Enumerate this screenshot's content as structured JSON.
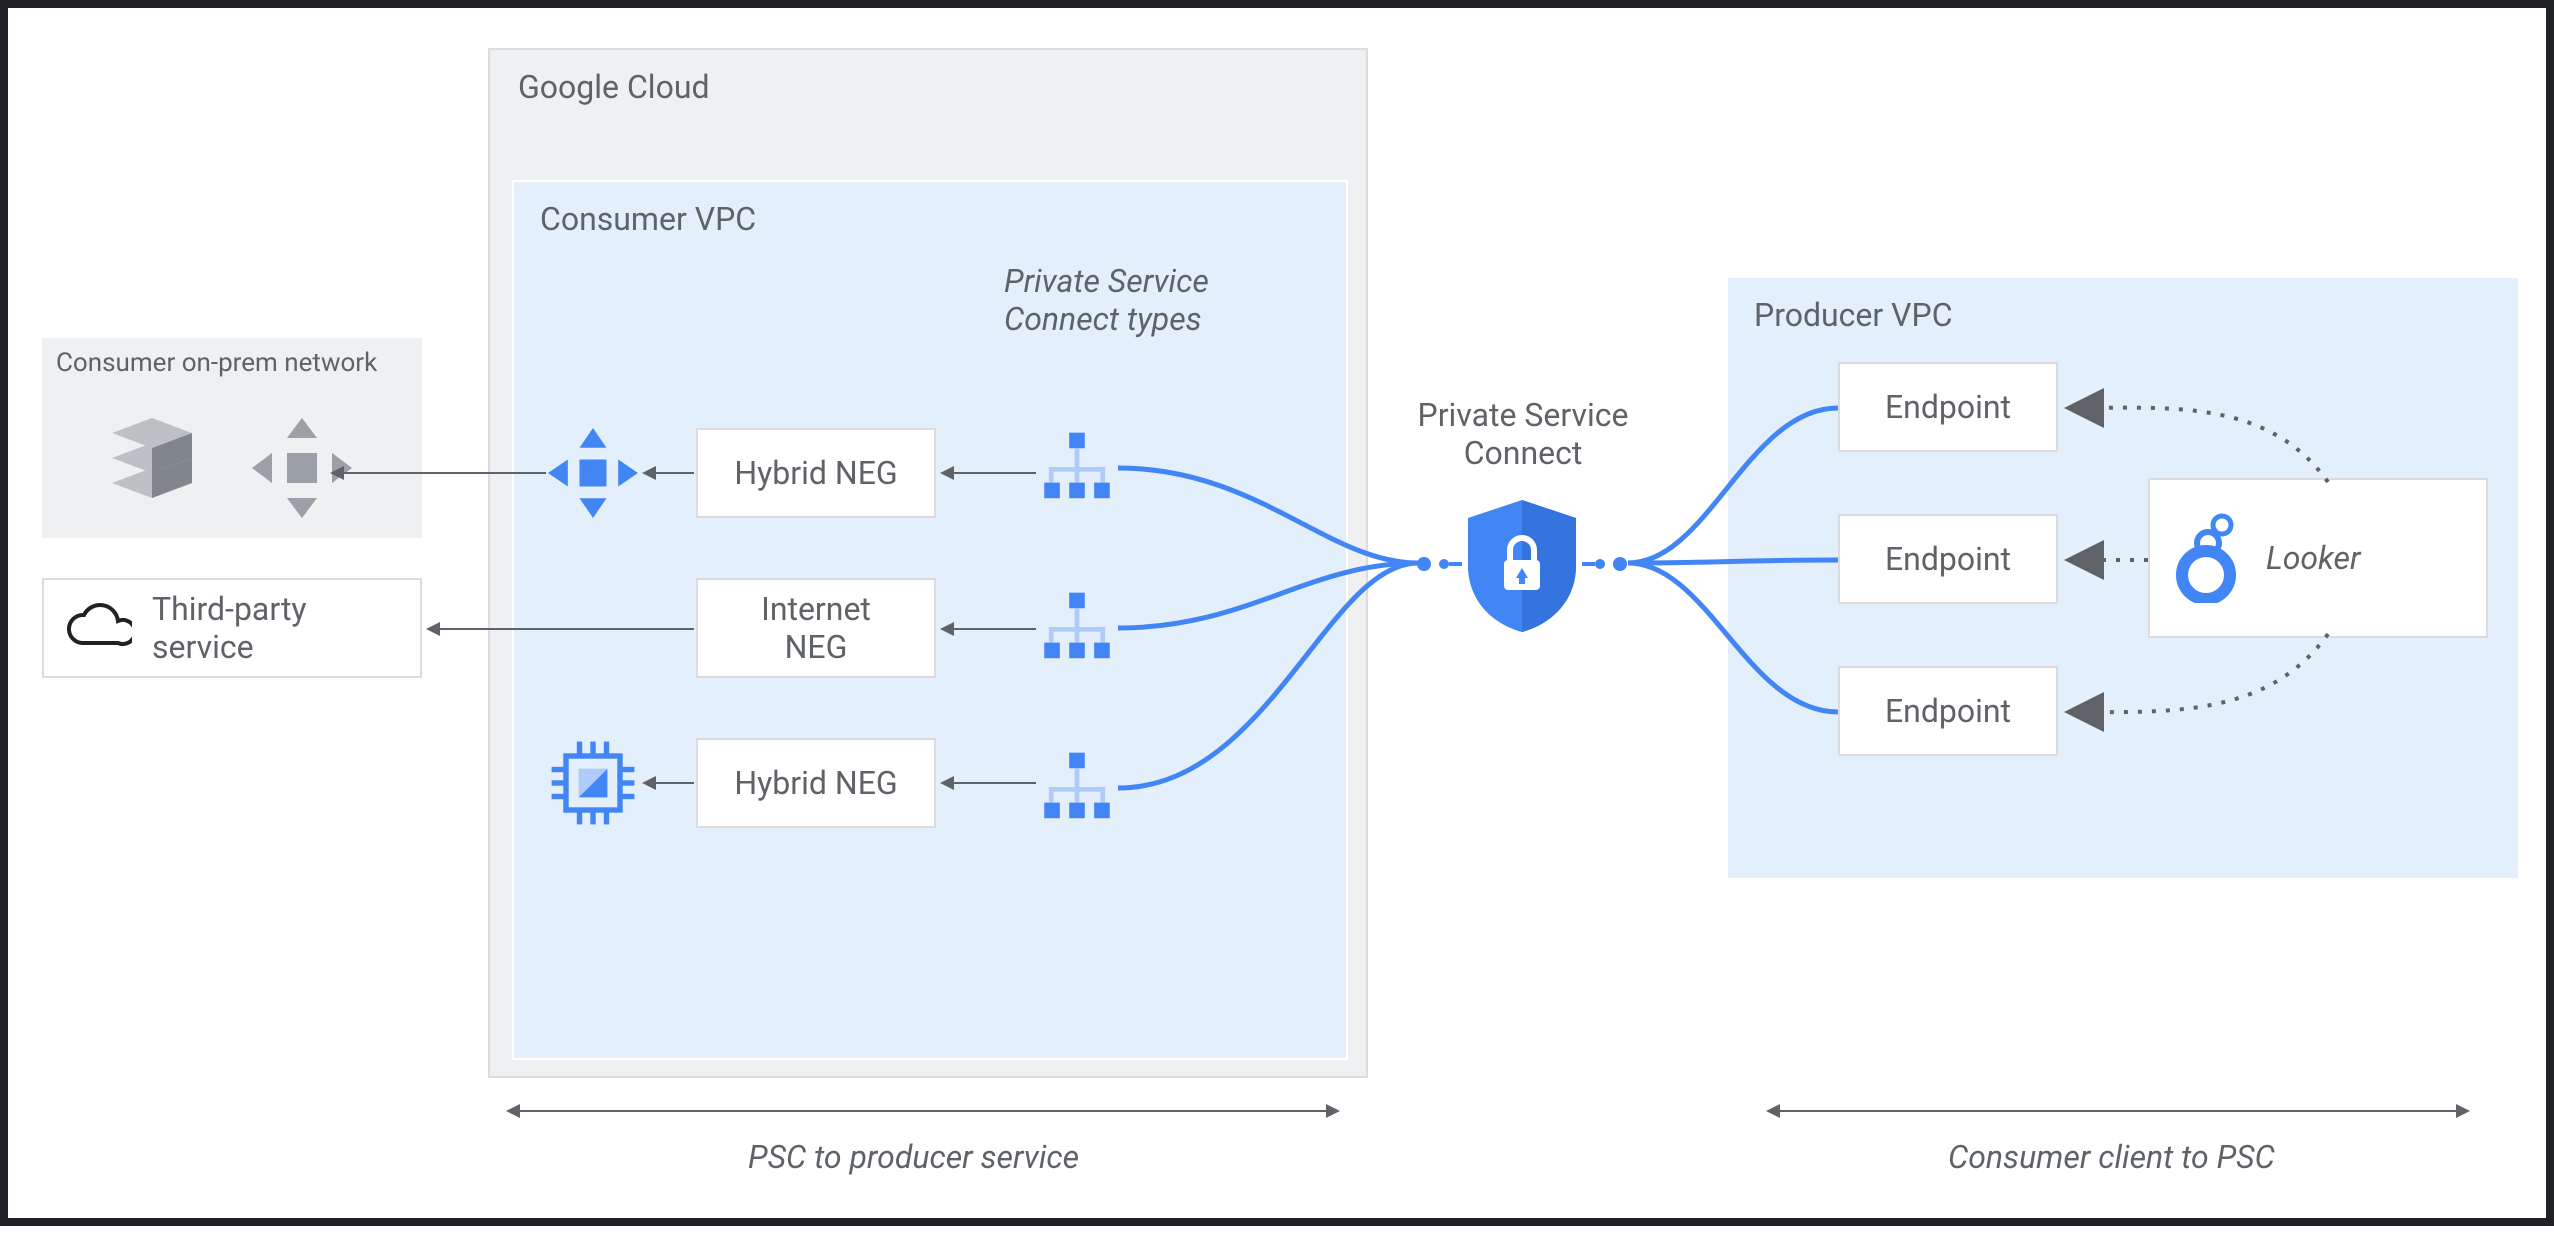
{
  "regions": {
    "google_cloud": "Google Cloud",
    "consumer_vpc": "Consumer VPC",
    "producer_vpc": "Producer VPC",
    "onprem": "Consumer on-prem network"
  },
  "psc_types_label": "Private Service\nConnect types",
  "psc_label": "Private Service\nConnect",
  "third_party": "Third-party\nservice",
  "negs": {
    "n1": "Hybrid NEG",
    "n2": "Internet\nNEG",
    "n3": "Hybrid NEG"
  },
  "endpoints": {
    "e1": "Endpoint",
    "e2": "Endpoint",
    "e3": "Endpoint"
  },
  "looker": "Looker",
  "footers": {
    "left": "PSC to producer service",
    "right": "Consumer client to PSC"
  },
  "colors": {
    "blue": "#4285f4",
    "light_blue_bg": "#e3f0fb",
    "gray_bg": "#eef0f2",
    "border": "#dadce0",
    "text": "#5f6368"
  }
}
